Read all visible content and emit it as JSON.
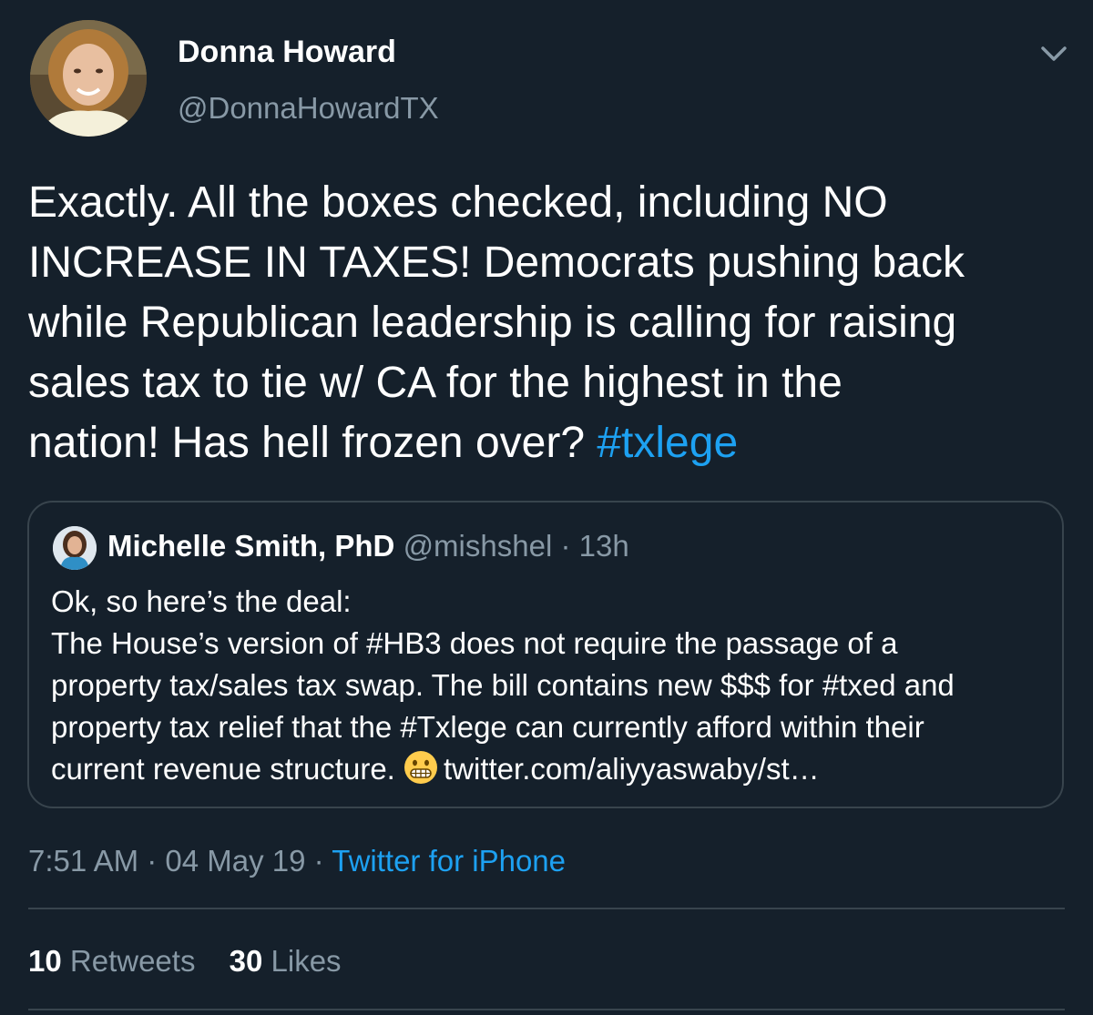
{
  "tweet": {
    "author": {
      "name": "Donna Howard",
      "handle": "@DonnaHowardTX"
    },
    "menu_icon": "chevron-down-icon",
    "text_lines": [
      "Exactly. All the boxes checked, including NO",
      "INCREASE IN TAXES! Democrats pushing back",
      "while Republican leadership is calling for raising",
      "sales tax to tie w/ CA for the highest in the",
      "nation! Has hell frozen over?"
    ],
    "hashtag": "#txlege",
    "quoted": {
      "name": "Michelle Smith, PhD",
      "handle": "@mishshel",
      "separator": " · ",
      "age": "13h",
      "lines": [
        "Ok, so here’s the deal:",
        "The House’s version of #HB3 does not require the passage of a",
        "property tax/sales tax swap. The bill contains new $$$ for #txed and",
        "property tax relief that the #Txlege can currently afford within their",
        "current revenue structure."
      ],
      "emoji": "grimacing-face-emoji",
      "link": "twitter.com/aliyyaswaby/st…"
    },
    "time": "7:51 AM",
    "date": "04 May 19",
    "dot": " · ",
    "source": "Twitter for iPhone",
    "stats": {
      "retweets_count": "10",
      "retweets_label": "Retweets",
      "likes_count": "30",
      "likes_label": "Likes"
    }
  },
  "colors": {
    "background": "#15202b",
    "text": "#ffffff",
    "secondary": "#8899a6",
    "accent": "#1da1f2",
    "border": "#38444d"
  }
}
